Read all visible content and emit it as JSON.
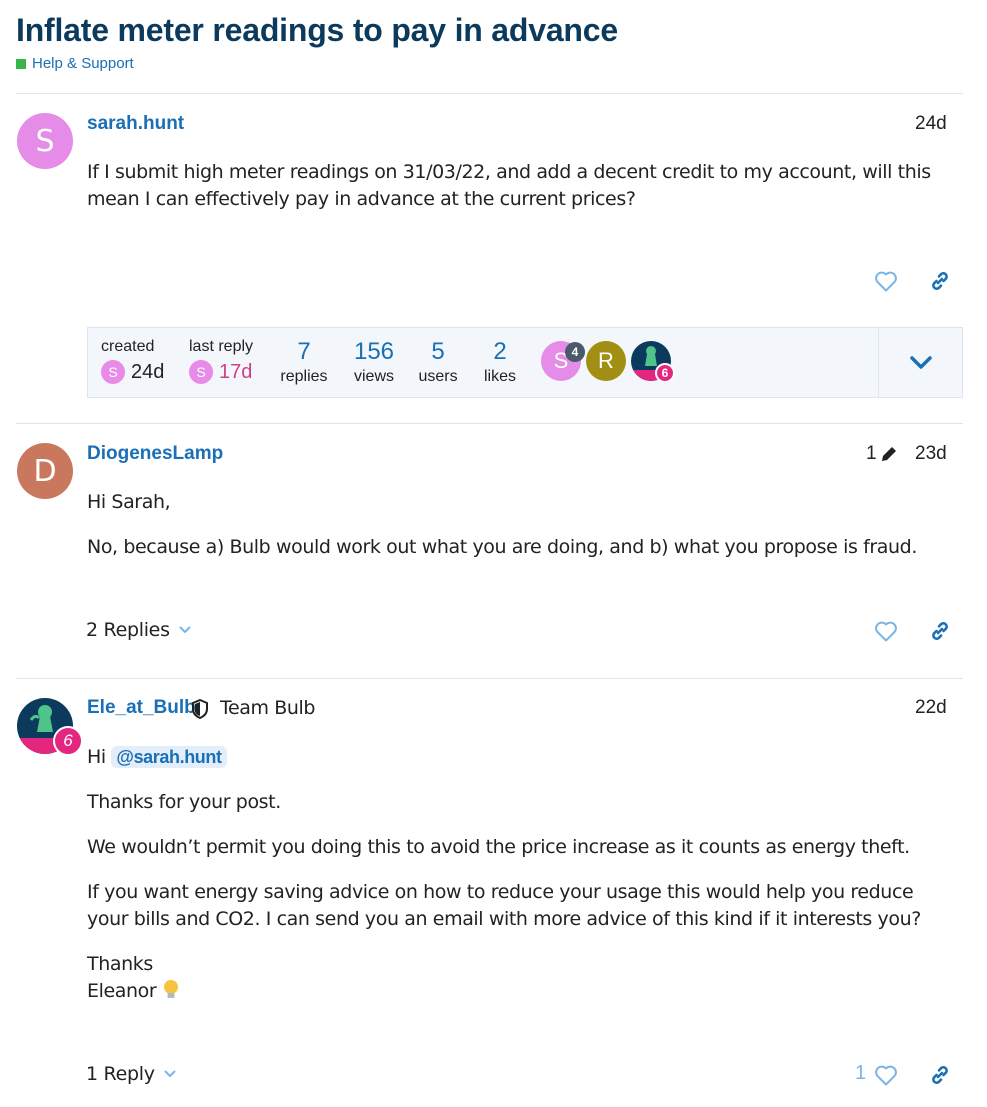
{
  "topic": {
    "title": "Inflate meter readings to pay in advance",
    "category": "Help & Support",
    "category_color": "#3ab54a"
  },
  "posts": [
    {
      "avatar_letter": "S",
      "avatar_color": "#e58be8",
      "username": "sarah.hunt",
      "date": "24d",
      "body": [
        "If I submit high meter readings on 31/03/22, and add a decent credit to my account, will this mean I can effectively pay in advance at the current prices?"
      ]
    },
    {
      "avatar_letter": "D",
      "avatar_color": "#c9785d",
      "username": "DiogenesLamp",
      "edit_count": "1",
      "date": "23d",
      "body": [
        "Hi Sarah,",
        "No, because a) Bulb would work out what you are doing, and b) what you propose is fraud."
      ],
      "replies_label": "2 Replies"
    },
    {
      "username": "Ele_at_Bulb",
      "flair": "Team Bulb",
      "avatar_badge": "6",
      "date": "22d",
      "greeting": "Hi",
      "mention": "@sarah.hunt",
      "body": [
        "Thanks for your post.",
        "We wouldn’t permit you doing this to avoid the price increase as it counts as energy theft.",
        "If you want energy saving advice on how to reduce your usage this would help you reduce your bills and CO2. I can send you an email with more advice of this kind if it interests you?"
      ],
      "signoff": "Thanks",
      "signature": "Eleanor",
      "replies_label": "1 Reply",
      "like_count": "1"
    }
  ],
  "topic_map": {
    "created_label": "created",
    "created_avatar": "S",
    "created_value": "24d",
    "last_reply_label": "last reply",
    "last_reply_avatar": "S",
    "last_reply_value": "17d",
    "replies_num": "7",
    "replies_label": "replies",
    "views_num": "156",
    "views_label": "views",
    "users_num": "5",
    "users_label": "users",
    "likes_num": "2",
    "likes_label": "likes",
    "participants": [
      {
        "letter": "S",
        "color": "#e58be8",
        "count": "4"
      },
      {
        "letter": "R",
        "color": "#a18f14"
      },
      {
        "letter": "",
        "color": "#0b3a5c",
        "count": "6"
      }
    ]
  },
  "icons": {
    "like": "heart-icon",
    "link": "link-icon",
    "edit": "pencil-icon",
    "expand": "chevron-down-icon",
    "flair": "shield-icon",
    "signature_emoji": "lightbulb-icon"
  },
  "colors": {
    "link": "#1a6fb5",
    "title": "#0b3a5c",
    "last_reply": "#d13f86",
    "badge": "#e3277f"
  }
}
